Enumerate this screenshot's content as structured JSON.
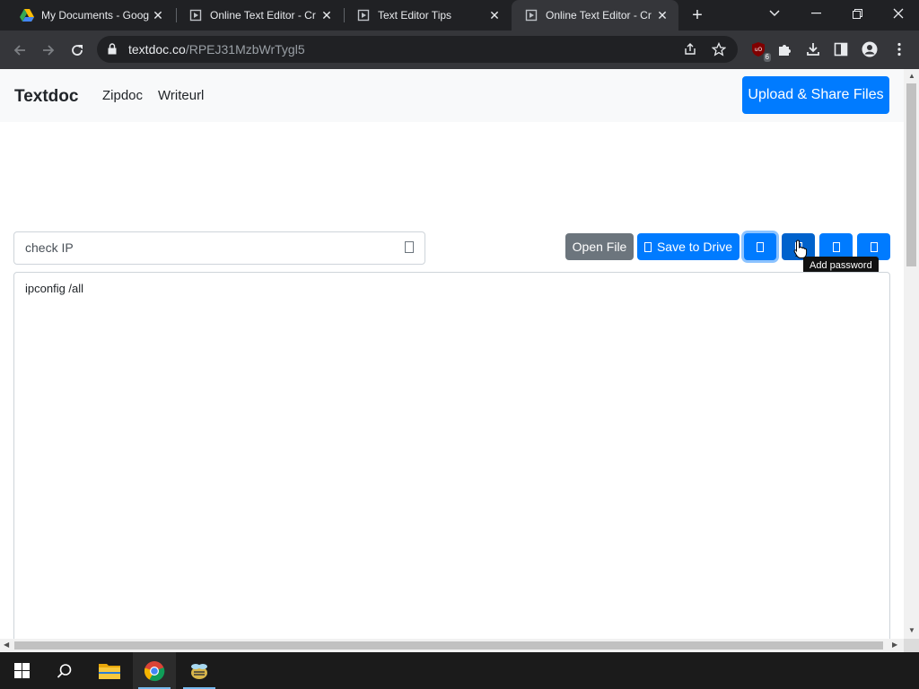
{
  "browser": {
    "tabs": [
      {
        "title": "My Documents - Goog",
        "favicon": "google-drive-icon",
        "active": false
      },
      {
        "title": "Online Text Editor - Cr",
        "favicon": "textdoc-favicon",
        "active": false
      },
      {
        "title": "Text Editor Tips",
        "favicon": "textdoc-favicon",
        "active": false
      },
      {
        "title": "Online Text Editor - Cr",
        "favicon": "textdoc-favicon",
        "active": true
      }
    ],
    "url_host": "textdoc.co",
    "url_path": "/RPEJ31MzbWrTygl5",
    "extension_badge": "6"
  },
  "navbar": {
    "brand": "Textdoc",
    "links": [
      "Zipdoc",
      "Writeurl"
    ],
    "upload_button": "Upload & Share Files"
  },
  "doc": {
    "filename_value": "check IP",
    "open_file": "Open File",
    "save_to_drive": "Save to Drive",
    "tooltip": "Add password",
    "content": "ipconfig /all"
  },
  "colors": {
    "primary": "#007bff",
    "secondary": "#6c757d",
    "navbar_bg": "#f8f9fa",
    "chrome_dark": "#202124"
  }
}
